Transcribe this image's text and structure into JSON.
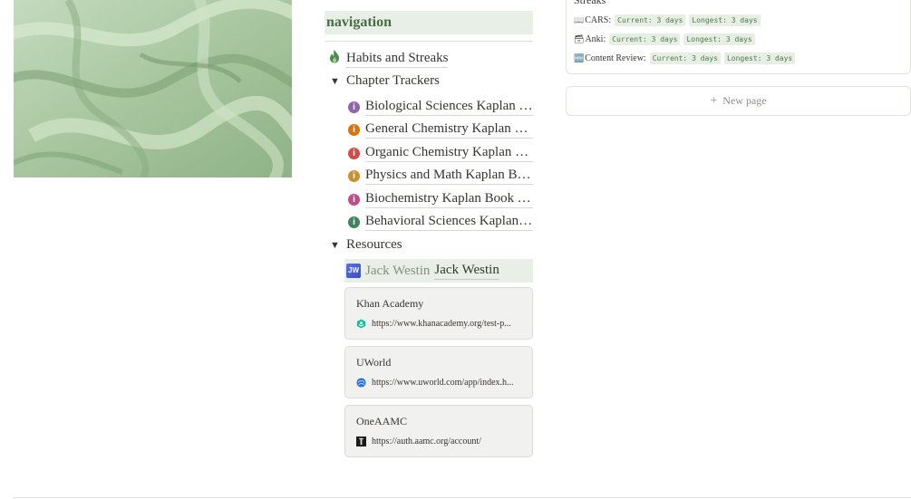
{
  "navigation": {
    "header": "navigation",
    "habits_item": {
      "label": "Habits and Streaks",
      "icon": "flame-icon"
    },
    "chapter_trackers": {
      "label": "Chapter Trackers",
      "items": [
        {
          "label": "Biological Sciences Kaplan Bo...",
          "color": "#9065b0"
        },
        {
          "label": "General Chemistry Kaplan Bo...",
          "color": "#d9730d"
        },
        {
          "label": "Organic Chemistry Kaplan Bo...",
          "color": "#d44c47"
        },
        {
          "label": "Physics and Math Kaplan Boo...",
          "color": "#cb912f"
        },
        {
          "label": "Biochemistry Kaplan Book Tr...",
          "color": "#c14c8a"
        },
        {
          "label": "Behavioral Sciences Kaplan B...",
          "color": "#448361"
        }
      ]
    },
    "resources": {
      "label": "Resources",
      "jack_westin": {
        "badge": "JW",
        "prefix": "Jack Westin",
        "label": "Jack Westin"
      },
      "bookmarks": [
        {
          "title": "Khan Academy",
          "url": "https://www.khanacademy.org/test-p...",
          "icon": "khan-academy-icon"
        },
        {
          "title": "UWorld",
          "url": "https://www.uworld.com/app/index.h...",
          "icon": "uworld-icon"
        },
        {
          "title": "OneAAMC",
          "url": "https://auth.aamc.org/account/",
          "icon": "aamc-icon"
        }
      ]
    }
  },
  "streaks": {
    "title": "Streaks",
    "rows": [
      {
        "emoji": "📖",
        "label": "CARS:",
        "current": "Current: 3 days",
        "longest": "Longest: 3 days"
      },
      {
        "emoji": "🗃",
        "label": "Anki:",
        "current": "Current: 3 days",
        "longest": "Longest: 3 days"
      },
      {
        "emoji": "🆕",
        "label": "Content Review:",
        "current": "Current: 3 days",
        "longest": "Longest: 3 days"
      }
    ]
  },
  "new_page": {
    "label": "New page"
  }
}
